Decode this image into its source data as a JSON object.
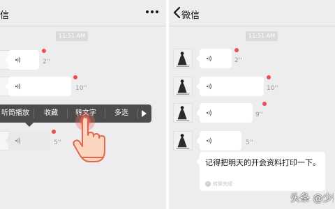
{
  "left": {
    "nav_title": "信",
    "time": "11:51 AM",
    "messages": [
      {
        "duration": "2''"
      },
      {
        "duration": "10''"
      },
      {
        "duration": "5''"
      }
    ],
    "menu": {
      "items": [
        "听筒播放",
        "收藏",
        "转文字",
        "多选"
      ]
    }
  },
  "right": {
    "nav_title": "微信",
    "time": "11:51 AM",
    "messages": [
      {
        "duration": "2''"
      },
      {
        "duration": "10''"
      },
      {
        "duration": "9''"
      },
      {
        "duration": "5''"
      }
    ],
    "transcript": "记得把明天的开会资料打印一下。",
    "status": "转换完成"
  },
  "watermark": "头条 @少数派",
  "colors": {
    "unread": "#f04d4d",
    "menu_bg": "#4c4c4c",
    "background": "#ededed"
  },
  "icons": [
    "more-icon",
    "back-icon",
    "voice-icon",
    "play-icon",
    "hand-pointer-icon",
    "check-icon"
  ]
}
